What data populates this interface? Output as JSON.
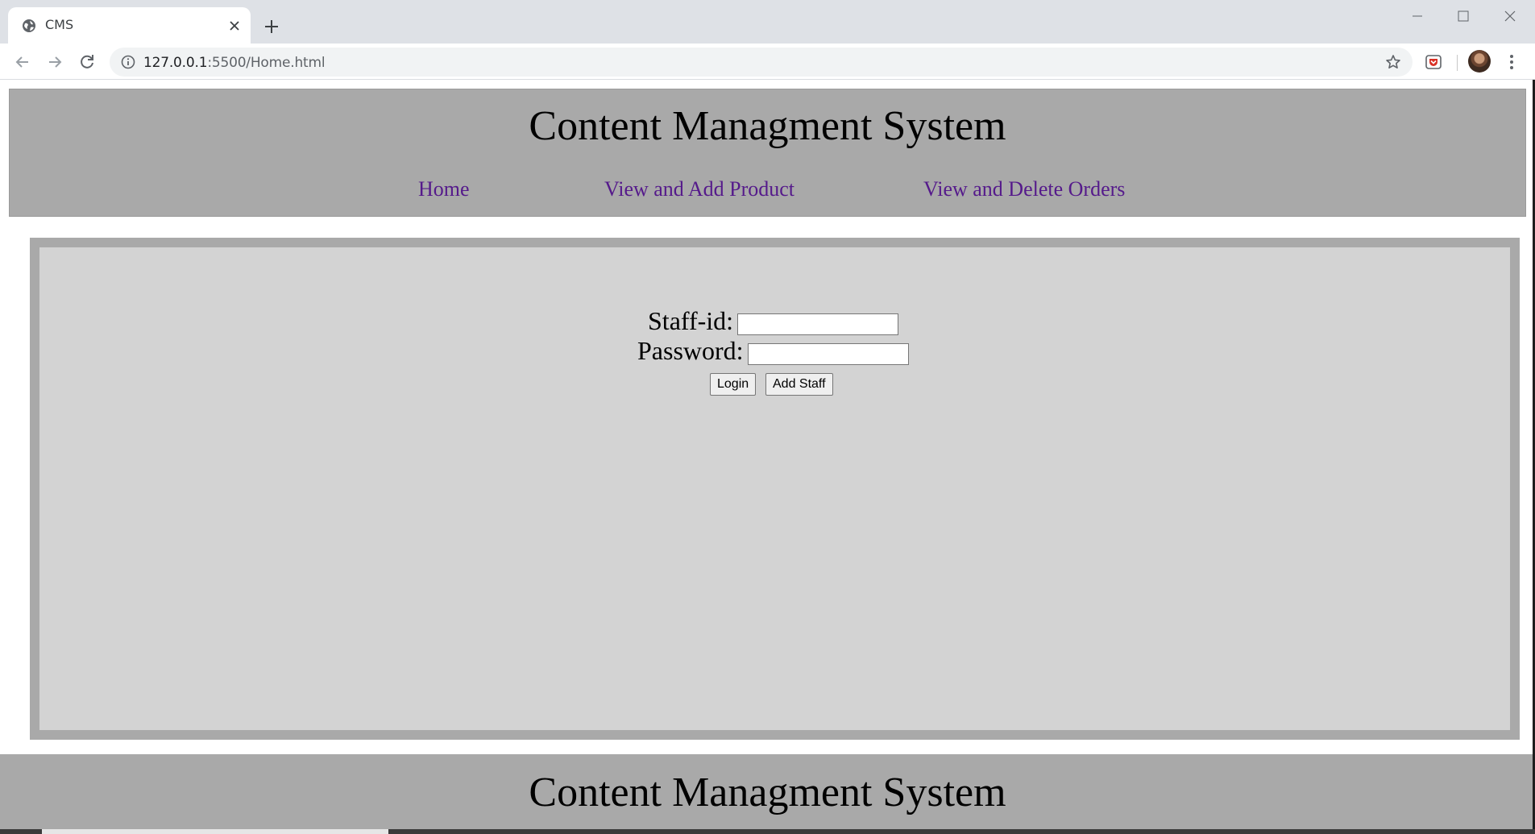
{
  "browser": {
    "tab_title": "CMS",
    "url_host": "127.0.0.1",
    "url_rest": ":5500/Home.html"
  },
  "site": {
    "title": "Content Managment System",
    "nav": [
      "Home",
      "View and Add Product",
      "View and Delete Orders"
    ],
    "footer_title": "Content Managment System"
  },
  "login_form": {
    "staff_id_label": "Staff-id:",
    "staff_id_value": "",
    "password_label": "Password:",
    "password_value": "",
    "login_button": "Login",
    "add_staff_button": "Add Staff"
  },
  "colors": {
    "header_bg": "#a9a9a9",
    "content_bg": "#d3d3d3",
    "link": "#551a8b"
  }
}
